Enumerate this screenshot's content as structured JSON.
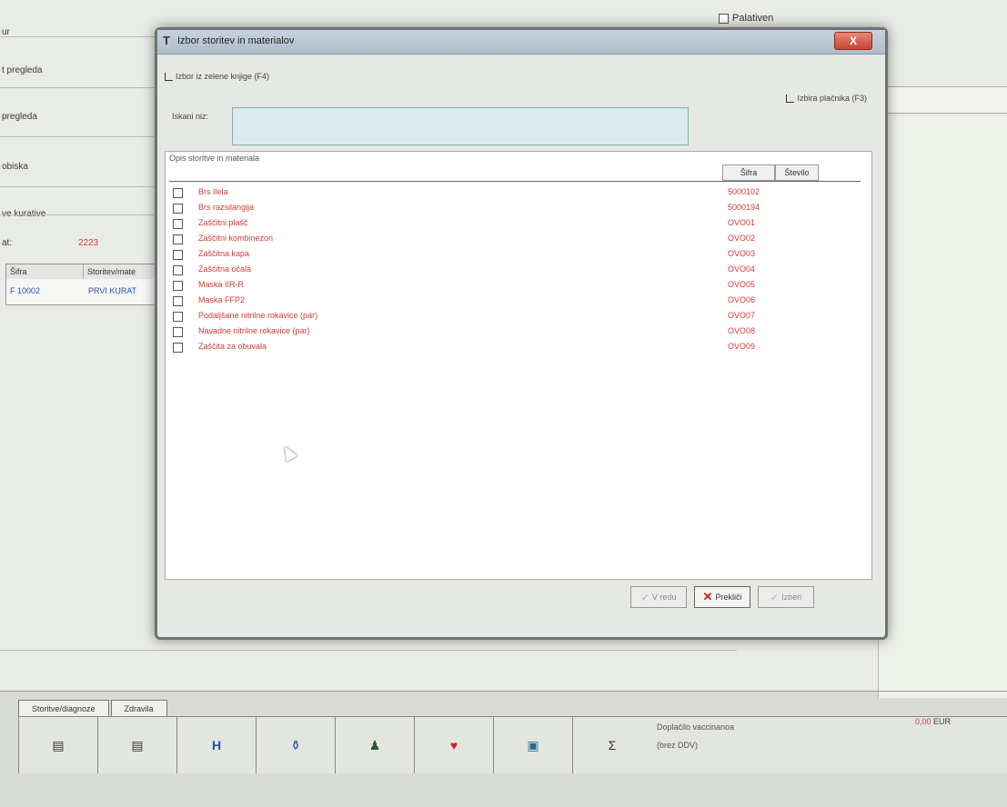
{
  "background": {
    "labels": [
      "ur",
      "t pregleda",
      "pregleda",
      "obiska",
      "ve kurative",
      "at:"
    ],
    "red_value": "2223",
    "palativen_label": "Palativen",
    "grid": {
      "col1": "Šifra",
      "col2": "Storitev/mate",
      "row_sifra": "F 10002",
      "row_text": "PRVI KURAT"
    }
  },
  "dialog": {
    "title": "Izbor storitev in materialov",
    "close_label": "X",
    "zelena_label": "Izbor iz zelene knjige (F4)",
    "izbira_label": "Izbira plačnika (F3)",
    "search_label": "Iskani niz:",
    "search_value": "",
    "list_title": "Opis storitve in materiala",
    "col_sifra": "Šifra",
    "col_stevilo": "Število",
    "items": [
      {
        "name": "Brs Ilela",
        "code": "5000102"
      },
      {
        "name": "Brs razsilangija",
        "code": "5000194"
      },
      {
        "name": "Zaščitni plašč",
        "code": "OVO01"
      },
      {
        "name": "Zaščitni kombinezon",
        "code": "OVO02"
      },
      {
        "name": "Zaščitna kapa",
        "code": "OVO03"
      },
      {
        "name": "Zaščitna očala",
        "code": "OVO04"
      },
      {
        "name": "Maska IIR-R",
        "code": "OVO05"
      },
      {
        "name": "Maska FFP2",
        "code": "OVO06"
      },
      {
        "name": "Podaljšane nitrilne rokavice (par)",
        "code": "OVO07"
      },
      {
        "name": "Navadne nitrilne rokavice (par)",
        "code": "OVO08"
      },
      {
        "name": "Zaščita za obuvala",
        "code": "OVO09"
      }
    ],
    "buttons": {
      "ok": "V redu",
      "cancel": "Prekliči",
      "other": "Izberi"
    }
  },
  "bottom": {
    "tabs": [
      "Storitve/diagnoze",
      "Zdravila"
    ],
    "toolbar_icons": [
      "save-icon",
      "save2-icon",
      "h-icon",
      "bottle-icon",
      "user-s-icon",
      "heart-icon",
      "camera-icon",
      "sigma-icon"
    ],
    "summary_line1": "Doplačilo vaccinanoa",
    "summary_line2": "(brez DDV)",
    "summary_value": "0,00",
    "summary_currency": "EUR"
  }
}
